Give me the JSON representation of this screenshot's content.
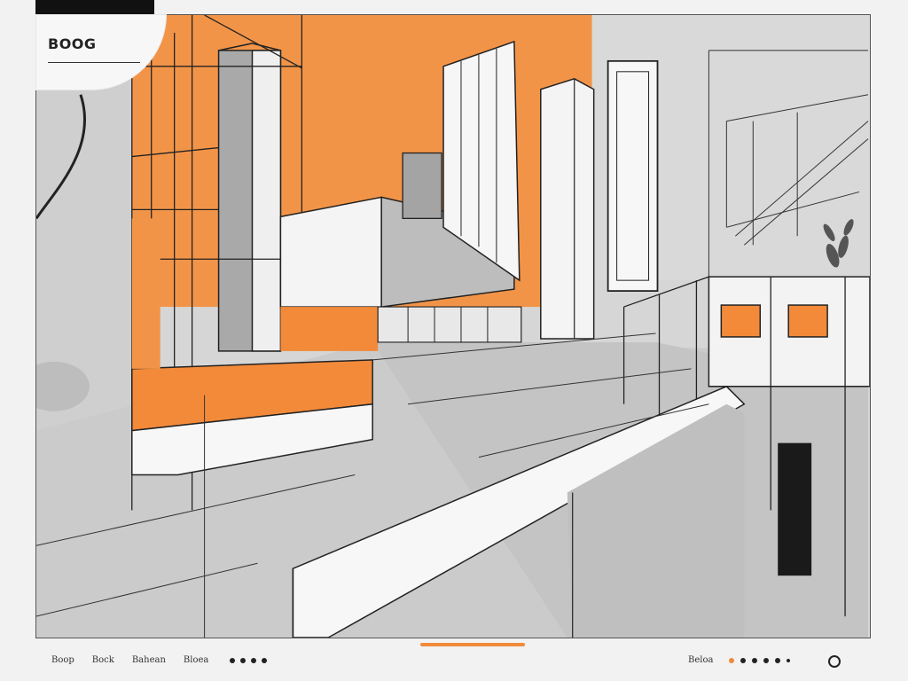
{
  "logo": {
    "text": "BOOG"
  },
  "bottom_nav": {
    "links": [
      "Boop",
      "Bock",
      "Bahean",
      "Bloea"
    ],
    "dot_count": 4
  },
  "right_nav": {
    "label": "Beloa",
    "dots": [
      "orange",
      "dark",
      "dark",
      "dark",
      "dark"
    ]
  },
  "colors": {
    "accent": "#f08a3b",
    "ink": "#111111",
    "paper": "#f2f2f2"
  },
  "icons": [
    "circle-outline-icon",
    "pagination-dot-icon"
  ]
}
